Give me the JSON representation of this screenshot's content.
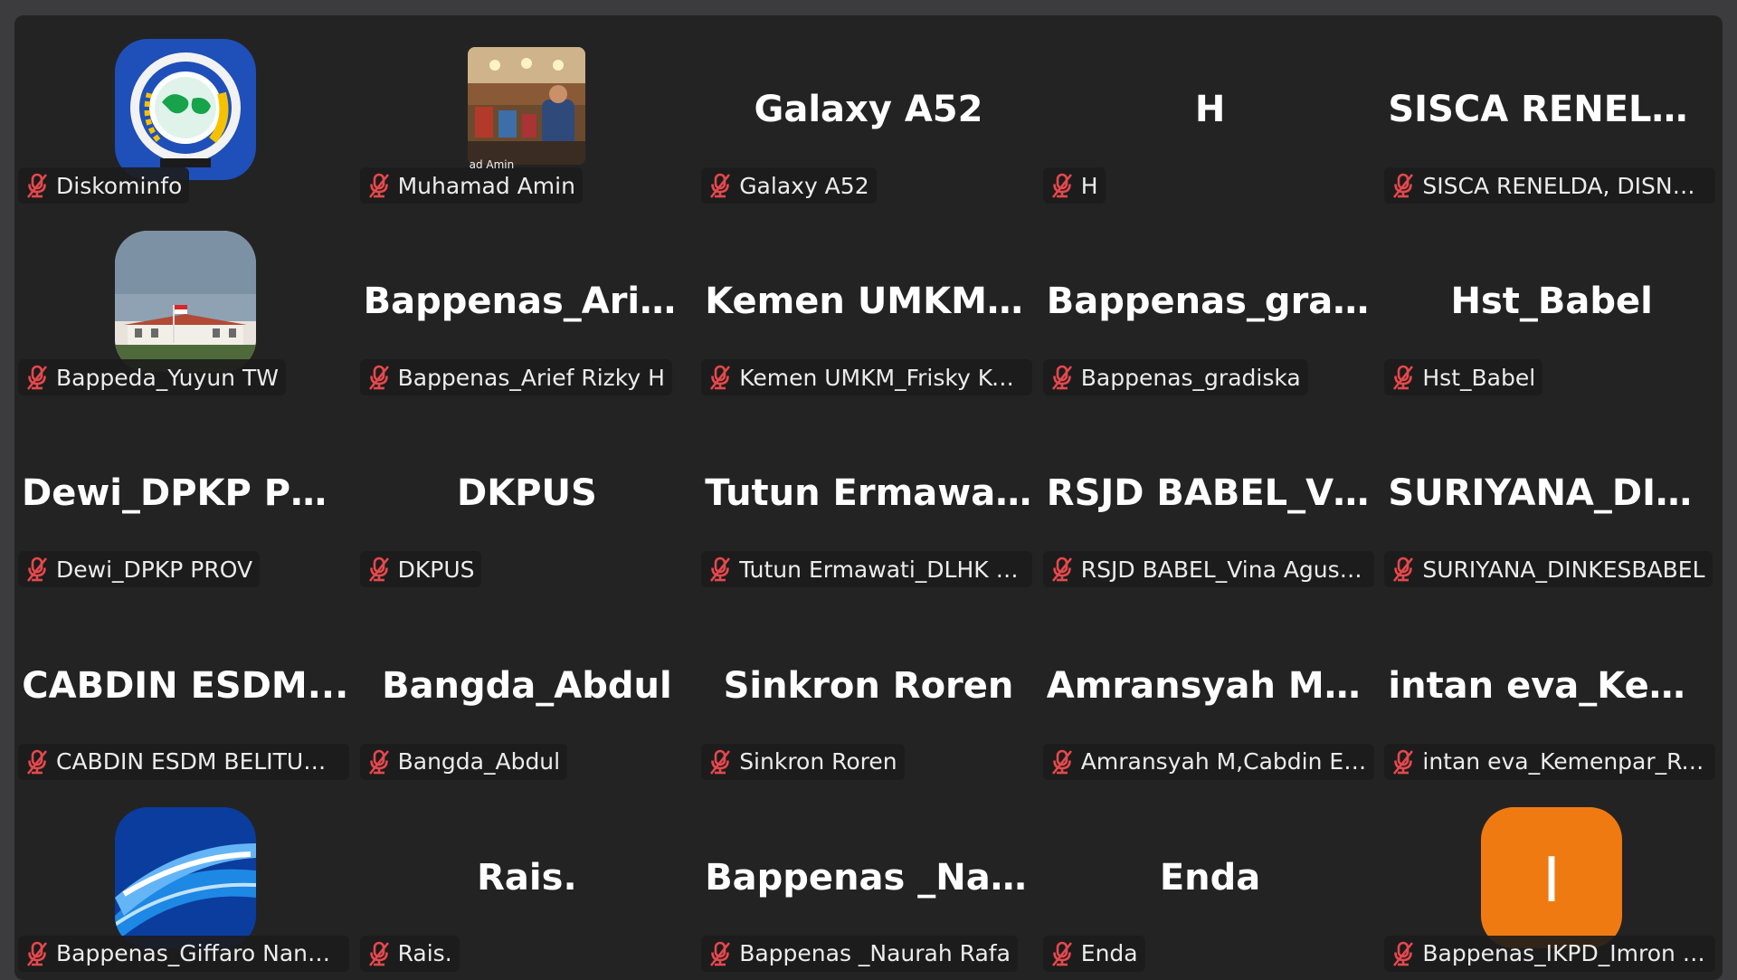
{
  "participants": [
    {
      "tile_name": "",
      "label": "Diskominfo",
      "avatar": "provincial-emblem"
    },
    {
      "tile_name": "",
      "label": "Muhamad Amin",
      "avatar": "meeting-room-photo",
      "photo_caption": "ad Amin"
    },
    {
      "tile_name": "Galaxy A52",
      "label": "Galaxy A52"
    },
    {
      "tile_name": "H",
      "label": "H"
    },
    {
      "tile_name": "SISCA  RENELDA...",
      "label": "SISCA RENELDA, DISNAKER"
    },
    {
      "tile_name": "",
      "label": "Bappeda_Yuyun TW",
      "avatar": "building-photo"
    },
    {
      "tile_name": "Bappenas_Arief...",
      "label": "Bappenas_Arief Rizky H"
    },
    {
      "tile_name": "Kemen  UMKM_...",
      "label": "Kemen UMKM_Frisky Komar..."
    },
    {
      "tile_name": "Bappenas_gradi...",
      "label": "Bappenas_gradiska"
    },
    {
      "tile_name": "Hst_Babel",
      "label": "Hst_Babel"
    },
    {
      "tile_name": "Dewi_DPKP PROV",
      "label": "Dewi_DPKP PROV"
    },
    {
      "tile_name": "DKPUS",
      "label": "DKPUS"
    },
    {
      "tile_name": "Tutun  Ermawati...",
      "label": "Tutun Ermawati_DLHK Babel"
    },
    {
      "tile_name": "RSJD  BABEL_Vin...",
      "label": "RSJD BABEL_Vina Agustin"
    },
    {
      "tile_name": "SURIYANA_DIN...",
      "label": "SURIYANA_DINKESBABEL"
    },
    {
      "tile_name": "CABDIN  ESDM...",
      "label": "CABDIN ESDM BELITUNG_M..."
    },
    {
      "tile_name": "Bangda_Abdul",
      "label": "Bangda_Abdul"
    },
    {
      "tile_name": "Sinkron Roren",
      "label": "Sinkron Roren"
    },
    {
      "tile_name": "Amransyah  M,C...",
      "label": "Amransyah M,Cabdin ESDM ..."
    },
    {
      "tile_name": "intan  eva_Keme...",
      "label": "intan eva_Kemenpar_Renkeu"
    },
    {
      "tile_name": "",
      "label": "Bappenas_Giffaro Nandra Ri...",
      "avatar": "blue-wave-image"
    },
    {
      "tile_name": "Rais.",
      "label": "Rais."
    },
    {
      "tile_name": "Bappenas  _Naur...",
      "label": "Bappenas _Naurah Rafa"
    },
    {
      "tile_name": "Enda",
      "label": "Enda"
    },
    {
      "tile_name": "",
      "label": "Bappenas_IKPD_Imron Amro...",
      "avatar": "letter-avatar",
      "avatar_letter": "I"
    }
  ],
  "icons": {
    "mute": "microphone-muted-icon"
  },
  "colors": {
    "background": "#232323",
    "frame": "#3c3c3e",
    "muted_red": "#e5484d",
    "letter_avatar": "#f07a12",
    "emblem_blue": "#1f4fb8"
  }
}
